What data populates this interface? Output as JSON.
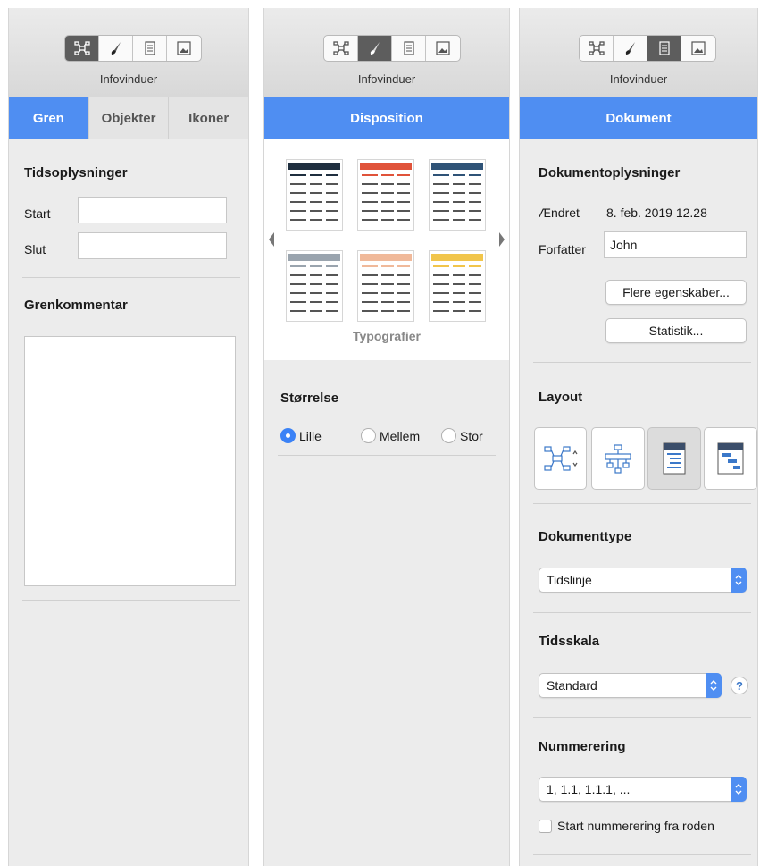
{
  "toolbar": {
    "title": "Infovinduer"
  },
  "panel1": {
    "tabs": [
      "Gren",
      "Objekter",
      "Ikoner"
    ],
    "time_heading": "Tidsoplysninger",
    "start_label": "Start",
    "end_label": "Slut",
    "start_value": "",
    "end_value": "",
    "comment_heading": "Grenkommentar"
  },
  "panel2": {
    "tab": "Disposition",
    "styles_label": "Typografier",
    "size_heading": "Størrelse",
    "sizes": [
      "Lille",
      "Mellem",
      "Stor"
    ],
    "selected_size": "Lille",
    "style_accents": [
      "#1f2f3f",
      "#e0533a",
      "#2f5377",
      "#9aa4ae",
      "#f0b99a",
      "#f1c54b"
    ]
  },
  "panel3": {
    "tab": "Dokument",
    "doc_heading": "Dokumentoplysninger",
    "modified_label": "Ændret",
    "modified_value": "8. feb. 2019 12.28",
    "author_label": "Forfatter",
    "author_value": "John",
    "more_button": "Flere egenskaber...",
    "stats_button": "Statistik...",
    "layout_heading": "Layout",
    "doctype_heading": "Dokumenttype",
    "doctype_value": "Tidslinje",
    "timescale_heading": "Tidsskala",
    "timescale_value": "Standard",
    "numbering_heading": "Nummerering",
    "numbering_value": "1, 1.1, 1.1.1, ...",
    "start_root_label": "Start nummerering fra roden",
    "help_label": "?"
  },
  "colors": {
    "accent": "#4f8ef2",
    "active_segment": "#5d5d5d"
  }
}
